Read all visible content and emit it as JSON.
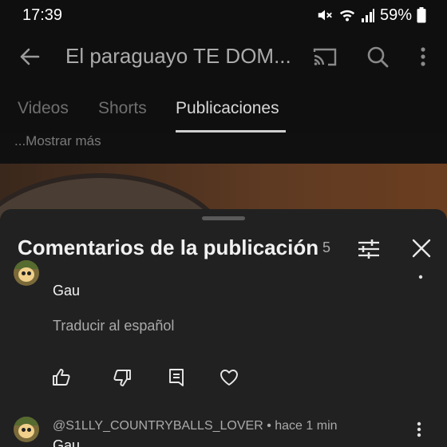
{
  "status_bar": {
    "time": "17:39",
    "battery": "59%"
  },
  "app_bar": {
    "title": "El paraguayo TE DOM...",
    "icons": [
      "arrow-left-icon",
      "cast-icon",
      "search-icon",
      "more-vertical-icon"
    ]
  },
  "tabs": [
    {
      "label": "Videos",
      "active": false
    },
    {
      "label": "Shorts",
      "active": false
    },
    {
      "label": "Publicaciones",
      "active": true
    }
  ],
  "post": {
    "show_more": "...Mostrar más"
  },
  "comments_sheet": {
    "title": "Comentarios de la publicación",
    "count": "5",
    "comments": [
      {
        "text": "Gau",
        "translate_label": "Traducir al español",
        "actions": [
          "thumbs-up-icon",
          "thumbs-down-icon",
          "reply-icon",
          "heart-icon"
        ]
      },
      {
        "author_line": "@S1LLY_COUNTRYBALLS_LOVER • hace 1 min",
        "text": "Gau"
      }
    ]
  },
  "colors": {
    "background": "#0f0f0f",
    "sheet": "#212121",
    "text_primary": "#f1f1f1",
    "text_secondary": "#aaaaaa"
  }
}
